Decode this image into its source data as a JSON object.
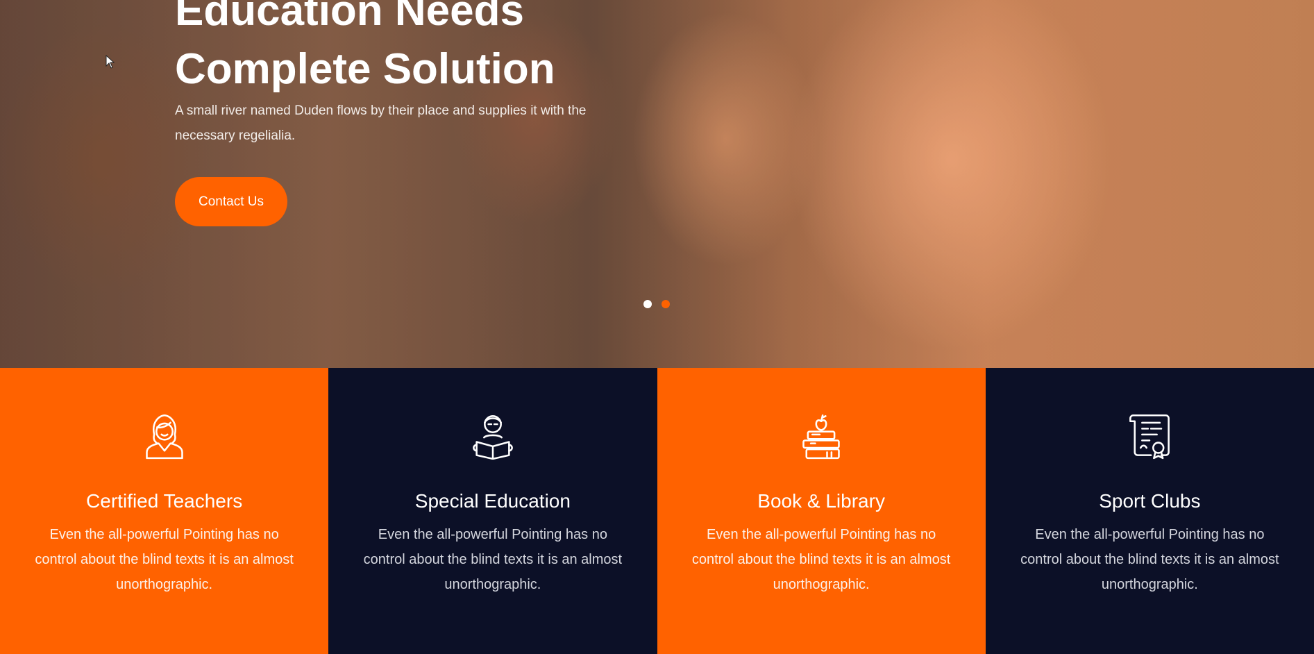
{
  "hero": {
    "title_line1": "Education Needs",
    "title_line2": "Complete Solution",
    "subtitle": "A small river named Duden flows by their place and supplies it with the necessary regelialia.",
    "cta_label": "Contact Us",
    "slides": [
      {
        "state": "inactive"
      },
      {
        "state": "active"
      }
    ]
  },
  "colors": {
    "accent": "#ff6200",
    "dark": "#0c1027",
    "dot_inactive": "#ffffff"
  },
  "features": [
    {
      "icon": "teacher-icon",
      "title": "Certified Teachers",
      "text": "Even the all-powerful Pointing has no control about the blind texts it is an almost unorthographic."
    },
    {
      "icon": "student-reading-icon",
      "title": "Special Education",
      "text": "Even the all-powerful Pointing has no control about the blind texts it is an almost unorthographic."
    },
    {
      "icon": "books-apple-icon",
      "title": "Book & Library",
      "text": "Even the all-powerful Pointing has no control about the blind texts it is an almost unorthographic."
    },
    {
      "icon": "certificate-icon",
      "title": "Sport Clubs",
      "text": "Even the all-powerful Pointing has no control about the blind texts it is an almost unorthographic."
    }
  ]
}
